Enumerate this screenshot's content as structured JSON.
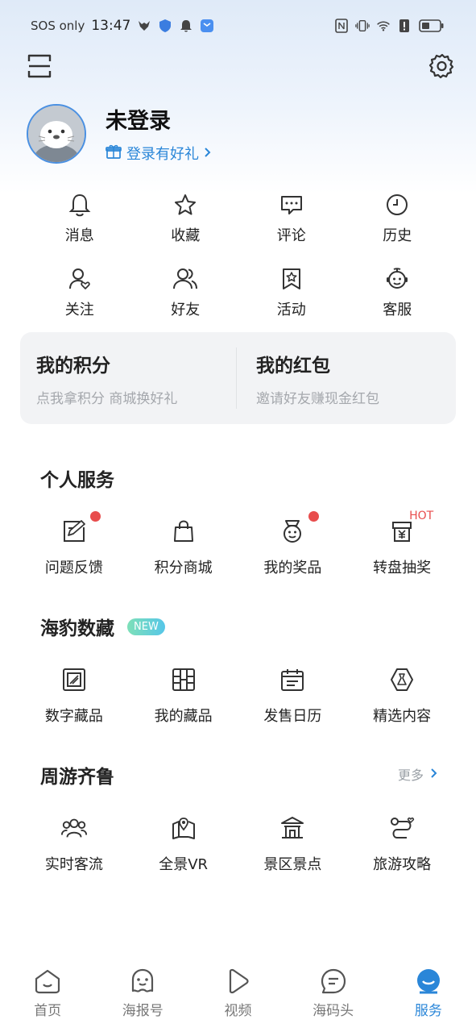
{
  "status_bar": {
    "carrier": "SOS only",
    "time": "13:47"
  },
  "profile": {
    "name": "未登录",
    "gift_link": "登录有好礼"
  },
  "quick_menu": [
    {
      "label": "消息",
      "icon": "bell-icon"
    },
    {
      "label": "收藏",
      "icon": "star-icon"
    },
    {
      "label": "评论",
      "icon": "comment-icon"
    },
    {
      "label": "历史",
      "icon": "clock-icon"
    },
    {
      "label": "关注",
      "icon": "follow-user-icon"
    },
    {
      "label": "好友",
      "icon": "friends-icon"
    },
    {
      "label": "活动",
      "icon": "activity-bookmark-icon"
    },
    {
      "label": "客服",
      "icon": "customer-service-icon"
    }
  ],
  "points_card": {
    "points": {
      "title": "我的积分",
      "subtitle": "点我拿积分 商城换好礼"
    },
    "red_packet": {
      "title": "我的红包",
      "subtitle": "邀请好友赚现金红包"
    }
  },
  "personal_services": {
    "title": "个人服务",
    "items": [
      {
        "label": "问题反馈",
        "icon": "feedback-edit-icon",
        "dot": true
      },
      {
        "label": "积分商城",
        "icon": "shopping-bag-icon",
        "dot": false
      },
      {
        "label": "我的奖品",
        "icon": "medal-icon",
        "dot": true
      },
      {
        "label": "转盘抽奖",
        "icon": "lottery-icon",
        "hot": "HOT"
      }
    ]
  },
  "digital_collection": {
    "title": "海豹数藏",
    "badge": "NEW",
    "items": [
      {
        "label": "数字藏品",
        "icon": "frame-icon"
      },
      {
        "label": "我的藏品",
        "icon": "grid-collection-icon"
      },
      {
        "label": "发售日历",
        "icon": "calendar-icon"
      },
      {
        "label": "精选内容",
        "icon": "featured-hexagon-icon"
      }
    ]
  },
  "travel": {
    "title": "周游齐鲁",
    "more": "更多",
    "items": [
      {
        "label": "实时客流",
        "icon": "crowd-icon"
      },
      {
        "label": "全景VR",
        "icon": "vr-location-icon"
      },
      {
        "label": "景区景点",
        "icon": "pavilion-icon"
      },
      {
        "label": "旅游攻略",
        "icon": "route-icon"
      }
    ]
  },
  "bottom_nav": [
    {
      "label": "首页",
      "icon": "home-icon"
    },
    {
      "label": "海报号",
      "icon": "ghost-icon"
    },
    {
      "label": "视频",
      "icon": "play-icon"
    },
    {
      "label": "海码头",
      "icon": "chat-icon"
    },
    {
      "label": "服务",
      "icon": "service-face-icon",
      "active": true
    }
  ],
  "colors": {
    "accent": "#2a86d8",
    "dot_red": "#e84d4d"
  }
}
